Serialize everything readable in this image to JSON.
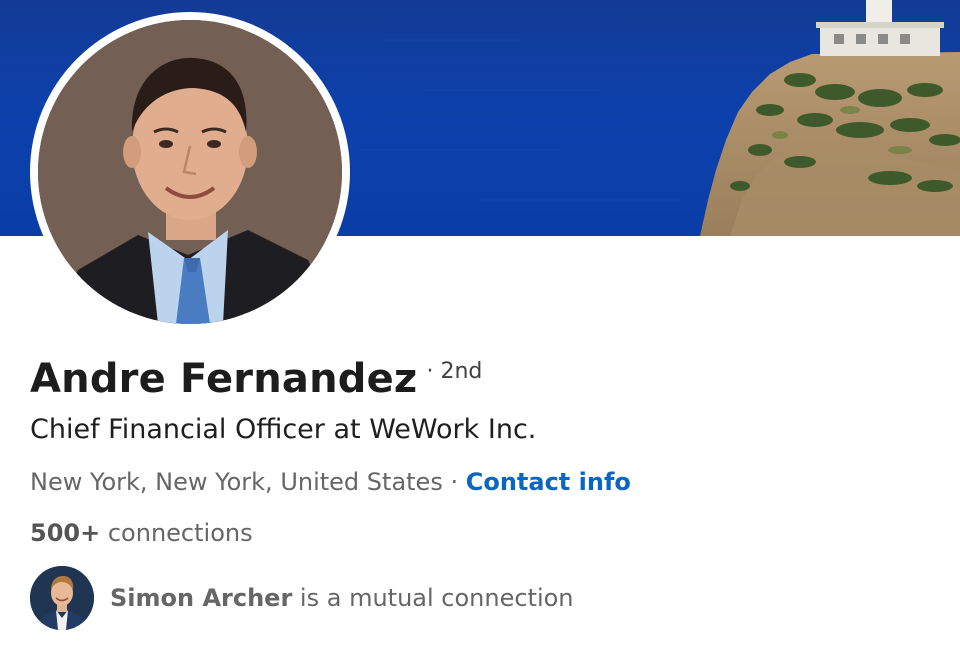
{
  "profile": {
    "name": "Andre Fernandez",
    "degree": "· 2nd",
    "headline": "Chief Financial Officer at WeWork Inc.",
    "location": "New York, New York, United States",
    "location_separator": " · ",
    "contact_info_label": "Contact info",
    "connections_count": "500+",
    "connections_label": " connections"
  },
  "mutual": {
    "name": "Simon Archer",
    "suffix": " is a mutual connection"
  },
  "colors": {
    "link": "#0a66c2",
    "cover_sea": "#0d40ac",
    "text_primary": "#1d1d1d",
    "text_secondary": "#666666"
  },
  "icons": {
    "cover": "cover-photo-lighthouse-cliff",
    "avatar": "profile-photo",
    "mutual_avatar": "mutual-connection-photo"
  }
}
